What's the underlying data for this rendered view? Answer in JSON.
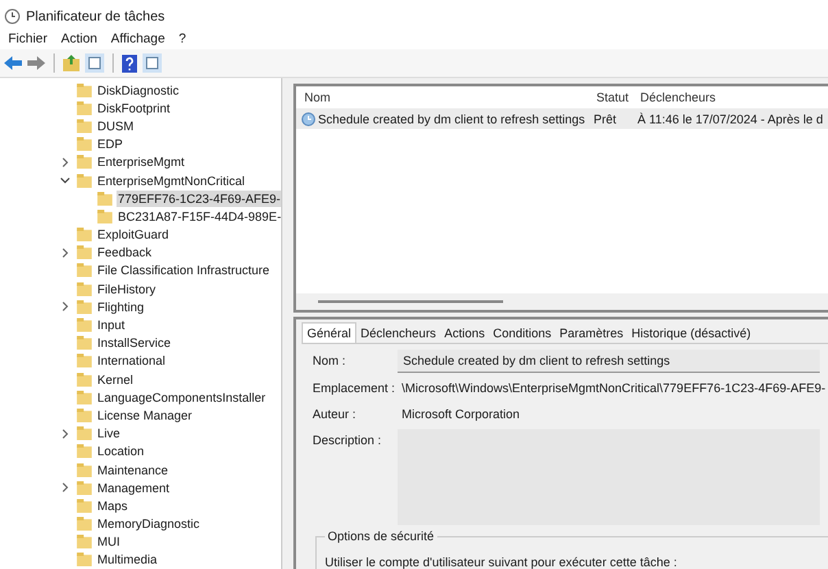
{
  "window": {
    "title": "Planificateur de tâches"
  },
  "menu": [
    {
      "label": "Fichier"
    },
    {
      "label": "Action"
    },
    {
      "label": "Affichage"
    },
    {
      "label": "?"
    }
  ],
  "tree": [
    {
      "label": "DiskDiagnostic",
      "has_children": false,
      "expanded": false,
      "selected": false
    },
    {
      "label": "DiskFootprint",
      "has_children": false,
      "expanded": false,
      "selected": false
    },
    {
      "label": "DUSM",
      "has_children": false,
      "expanded": false,
      "selected": false
    },
    {
      "label": "EDP",
      "has_children": false,
      "expanded": false,
      "selected": false
    },
    {
      "label": "EnterpriseMgmt",
      "has_children": true,
      "expanded": false,
      "selected": false
    },
    {
      "label": "EnterpriseMgmtNonCritical",
      "has_children": true,
      "expanded": true,
      "selected": false,
      "children": [
        {
          "label": "779EFF76-1C23-4F69-AFE9-",
          "has_children": false,
          "expanded": false,
          "selected": true
        },
        {
          "label": "BC231A87-F15F-44D4-989E-",
          "has_children": false,
          "expanded": false,
          "selected": false
        }
      ]
    },
    {
      "label": "ExploitGuard",
      "has_children": false,
      "expanded": false,
      "selected": false
    },
    {
      "label": "Feedback",
      "has_children": true,
      "expanded": false,
      "selected": false
    },
    {
      "label": "File Classification Infrastructure",
      "has_children": false,
      "expanded": false,
      "selected": false
    },
    {
      "label": "FileHistory",
      "has_children": false,
      "expanded": false,
      "selected": false
    },
    {
      "label": "Flighting",
      "has_children": true,
      "expanded": false,
      "selected": false
    },
    {
      "label": "Input",
      "has_children": false,
      "expanded": false,
      "selected": false
    },
    {
      "label": "InstallService",
      "has_children": false,
      "expanded": false,
      "selected": false
    },
    {
      "label": "International",
      "has_children": false,
      "expanded": false,
      "selected": false
    },
    {
      "label": "Kernel",
      "has_children": false,
      "expanded": false,
      "selected": false
    },
    {
      "label": "LanguageComponentsInstaller",
      "has_children": false,
      "expanded": false,
      "selected": false
    },
    {
      "label": "License Manager",
      "has_children": false,
      "expanded": false,
      "selected": false
    },
    {
      "label": "Live",
      "has_children": true,
      "expanded": false,
      "selected": false
    },
    {
      "label": "Location",
      "has_children": false,
      "expanded": false,
      "selected": false
    },
    {
      "label": "Maintenance",
      "has_children": false,
      "expanded": false,
      "selected": false
    },
    {
      "label": "Management",
      "has_children": true,
      "expanded": false,
      "selected": false
    },
    {
      "label": "Maps",
      "has_children": false,
      "expanded": false,
      "selected": false
    },
    {
      "label": "MemoryDiagnostic",
      "has_children": false,
      "expanded": false,
      "selected": false
    },
    {
      "label": "MUI",
      "has_children": false,
      "expanded": false,
      "selected": false
    },
    {
      "label": "Multimedia",
      "has_children": false,
      "expanded": false,
      "selected": false
    }
  ],
  "task_table": {
    "columns": [
      "Nom",
      "Statut",
      "Déclencheurs"
    ],
    "rows": [
      {
        "cells": [
          "Schedule created by dm client to refresh settings",
          "Prêt",
          "À 11:46 le 17/07/2024 - Après le d"
        ],
        "selected": true
      }
    ]
  },
  "details": {
    "tabs": [
      {
        "label": "Général",
        "selected": true
      },
      {
        "label": "Déclencheurs",
        "selected": false
      },
      {
        "label": "Actions",
        "selected": false
      },
      {
        "label": "Conditions",
        "selected": false
      },
      {
        "label": "Paramètres",
        "selected": false
      },
      {
        "label": "Historique (désactivé)",
        "selected": false
      }
    ],
    "fields": [
      {
        "kind": "box",
        "label": "Nom :",
        "value": "Schedule created by dm client to refresh settings"
      },
      {
        "kind": "plain",
        "label": "Emplacement :",
        "value": "\\Microsoft\\Windows\\EnterpriseMgmtNonCritical\\779EFF76-1C23-4F69-AFE9-"
      },
      {
        "kind": "plain",
        "label": "Auteur :",
        "value": "Microsoft Corporation"
      },
      {
        "kind": "area",
        "label": "Description :"
      }
    ],
    "security": {
      "title": "Options de sécurité",
      "text": "Utiliser le compte d'utilisateur suivant pour exécuter cette tâche :"
    }
  }
}
